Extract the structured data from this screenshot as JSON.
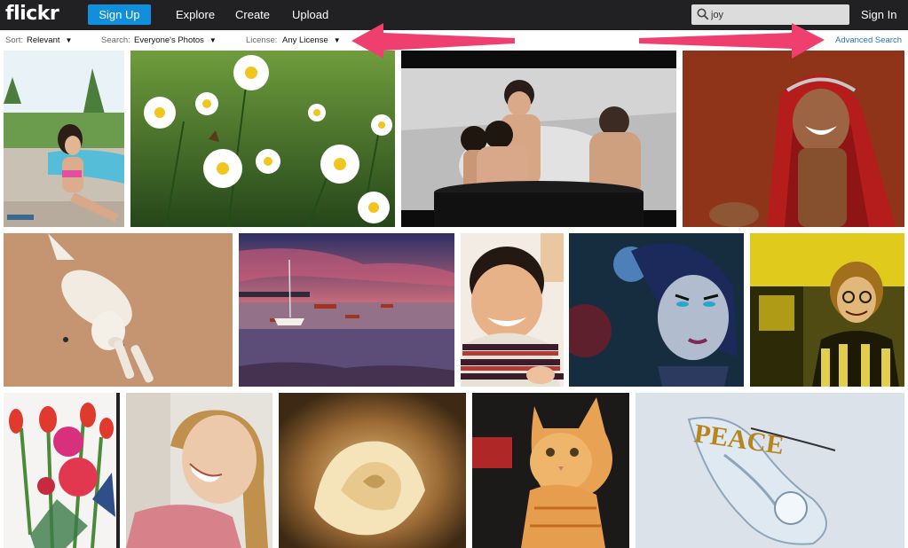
{
  "header": {
    "logo": "flickr",
    "signup_label": "Sign Up",
    "nav": [
      "Explore",
      "Create",
      "Upload"
    ],
    "search_value": "joy",
    "signin_label": "Sign In"
  },
  "filters": {
    "sort_label": "Sort:",
    "sort_value": "Relevant",
    "search_label": "Search:",
    "search_value": "Everyone's Photos",
    "license_label": "License:",
    "license_value": "Any License",
    "advanced_label": "Advanced Search"
  },
  "colors": {
    "topbar": "#212124",
    "signup_blue": "#128fdc",
    "annotation_arrow": "#ee3f6f",
    "link": "#2a72b8"
  },
  "photos": [
    {
      "subject": "girl by pool"
    },
    {
      "subject": "daisies"
    },
    {
      "subject": "kids in tub splash"
    },
    {
      "subject": "laughing girl in red scarf"
    },
    {
      "subject": "white dog stretching"
    },
    {
      "subject": "boats at sunset"
    },
    {
      "subject": "smiling boy"
    },
    {
      "subject": "fantasy woman art"
    },
    {
      "subject": "woman with glasses yellow"
    },
    {
      "subject": "watercolor tulips"
    },
    {
      "subject": "laughing girl"
    },
    {
      "subject": "soft rose"
    },
    {
      "subject": "orange kitten"
    },
    {
      "subject": "peace glass sculpture in snow"
    }
  ]
}
